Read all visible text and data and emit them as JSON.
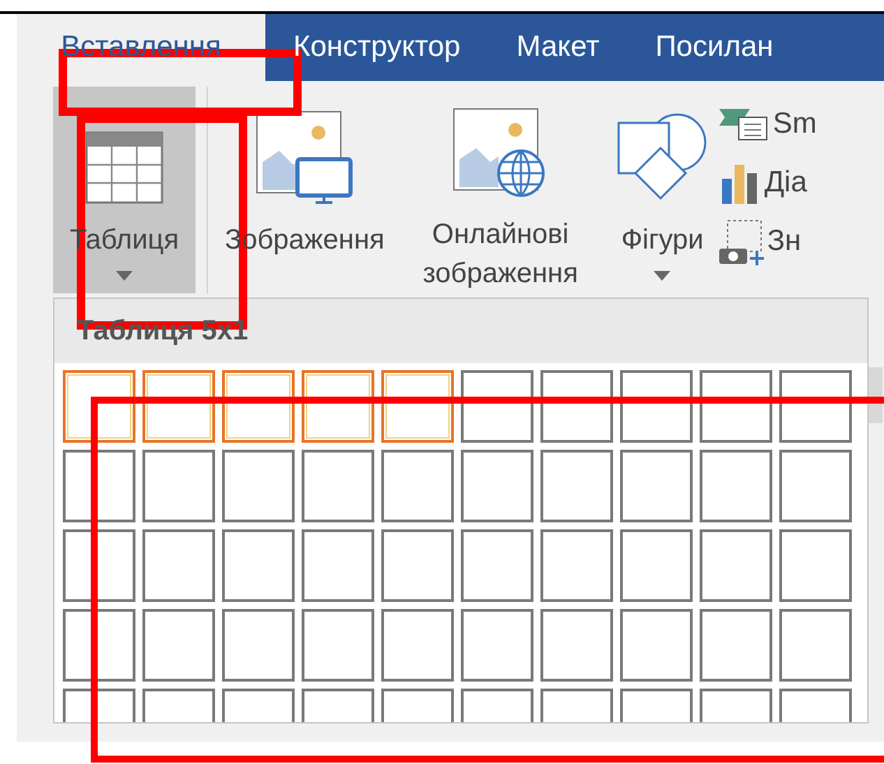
{
  "tabs": [
    {
      "label": "Вставлення",
      "selected": true
    },
    {
      "label": "Конструктор",
      "selected": false
    },
    {
      "label": "Макет",
      "selected": false
    },
    {
      "label": "Посилан",
      "selected": false
    }
  ],
  "ribbon": {
    "buttons": [
      {
        "kind": "table",
        "label": "Таблиця",
        "dropdown": true,
        "selected": true
      },
      {
        "kind": "pictures",
        "label": "Зображення",
        "dropdown": false,
        "selected": false
      },
      {
        "kind": "online",
        "label": "Онлайнові зображення",
        "dropdown": false,
        "selected": false
      },
      {
        "kind": "shapes",
        "label": "Фігури",
        "dropdown": true,
        "selected": false
      }
    ],
    "small_buttons": [
      {
        "kind": "smartart",
        "label": "Sm"
      },
      {
        "kind": "chart",
        "label": "Діа"
      },
      {
        "kind": "screenshot",
        "label": "Зн"
      }
    ]
  },
  "dropdown": {
    "title": "Таблиця 5x1",
    "rows": [
      {
        "cells": [
          {
            "highlighted": true
          },
          {
            "highlighted": true
          },
          {
            "highlighted": true
          },
          {
            "highlighted": true
          },
          {
            "highlighted": true
          },
          {
            "highlighted": false
          },
          {
            "highlighted": false
          },
          {
            "highlighted": false
          },
          {
            "highlighted": false
          },
          {
            "highlighted": false
          }
        ]
      },
      {
        "cells": [
          {
            "highlighted": false
          },
          {
            "highlighted": false
          },
          {
            "highlighted": false
          },
          {
            "highlighted": false
          },
          {
            "highlighted": false
          },
          {
            "highlighted": false
          },
          {
            "highlighted": false
          },
          {
            "highlighted": false
          },
          {
            "highlighted": false
          },
          {
            "highlighted": false
          }
        ]
      },
      {
        "cells": [
          {
            "highlighted": false
          },
          {
            "highlighted": false
          },
          {
            "highlighted": false
          },
          {
            "highlighted": false
          },
          {
            "highlighted": false
          },
          {
            "highlighted": false
          },
          {
            "highlighted": false
          },
          {
            "highlighted": false
          },
          {
            "highlighted": false
          },
          {
            "highlighted": false
          }
        ]
      },
      {
        "cells": [
          {
            "highlighted": false
          },
          {
            "highlighted": false
          },
          {
            "highlighted": false
          },
          {
            "highlighted": false
          },
          {
            "highlighted": false
          },
          {
            "highlighted": false
          },
          {
            "highlighted": false
          },
          {
            "highlighted": false
          },
          {
            "highlighted": false
          },
          {
            "highlighted": false
          }
        ]
      },
      {
        "cells": [
          {
            "highlighted": false
          },
          {
            "highlighted": false
          },
          {
            "highlighted": false
          },
          {
            "highlighted": false
          },
          {
            "highlighted": false
          },
          {
            "highlighted": false
          },
          {
            "highlighted": false
          },
          {
            "highlighted": false
          },
          {
            "highlighted": false
          },
          {
            "highlighted": false
          }
        ]
      }
    ]
  }
}
